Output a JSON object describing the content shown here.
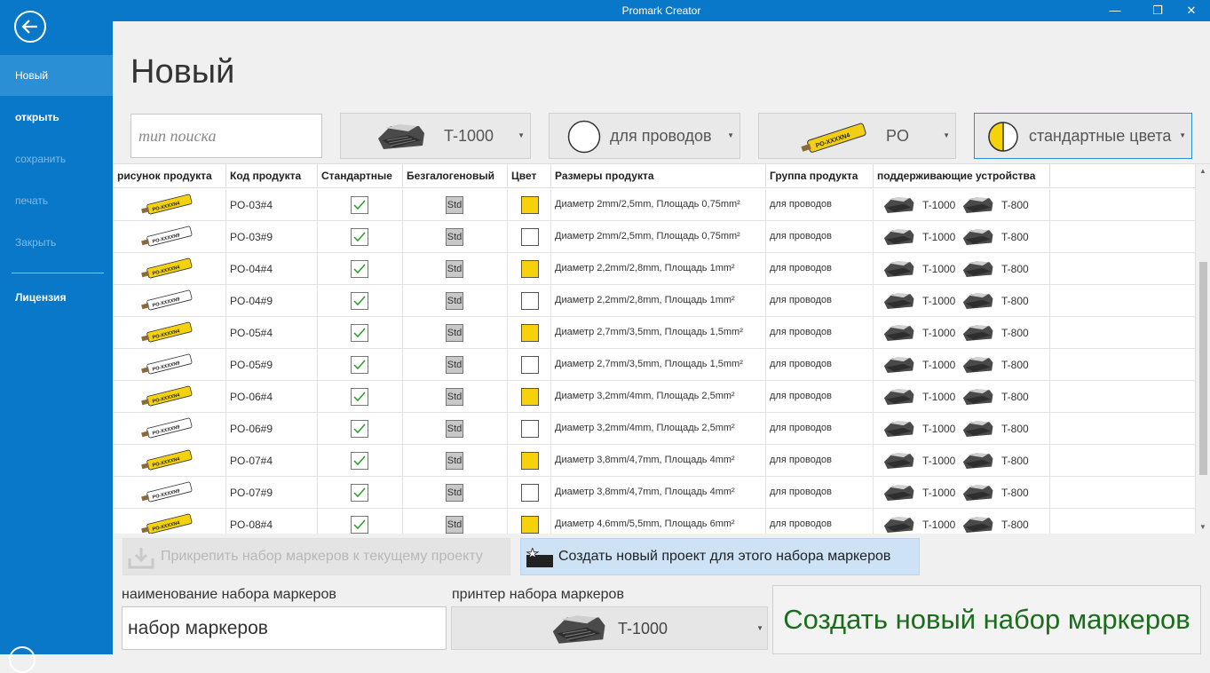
{
  "window": {
    "title": "Promark Creator"
  },
  "sidebar": {
    "items": [
      {
        "label": "Новый",
        "state": "active"
      },
      {
        "label": "открыть",
        "state": "bold"
      },
      {
        "label": "сохранить",
        "state": "disabled"
      },
      {
        "label": "печать",
        "state": "disabled"
      },
      {
        "label": "Закрыть",
        "state": "disabled"
      },
      {
        "label": "Лицензия",
        "state": "bold"
      }
    ]
  },
  "page": {
    "title": "Новый"
  },
  "search": {
    "placeholder": "тип поиска"
  },
  "filters": {
    "printer": "T-1000",
    "category": "для проводов",
    "series": "PO",
    "colors": "стандартные цвета"
  },
  "grid": {
    "headers": [
      "рисунок продукта",
      "Код продукта",
      "Стандартные",
      "Безгалогеновый",
      "Цвет",
      "Размеры продукта",
      "Группа продукта",
      "поддерживающие устройства"
    ],
    "rows": [
      {
        "code": "PO-03#4",
        "standard": true,
        "halogen_free": "Std",
        "color": "#f5d20a",
        "marker_text": "PO-XXXXN4",
        "size": "Диаметр 2mm/2,5mm, Площадь 0,75mm²",
        "group": "для проводов",
        "dev1": "T-1000",
        "dev2": "T-800"
      },
      {
        "code": "PO-03#9",
        "standard": true,
        "halogen_free": "Std",
        "color": "#ffffff",
        "marker_text": "PO-XXXXN9",
        "size": "Диаметр 2mm/2,5mm, Площадь 0,75mm²",
        "group": "для проводов",
        "dev1": "T-1000",
        "dev2": "T-800"
      },
      {
        "code": "PO-04#4",
        "standard": true,
        "halogen_free": "Std",
        "color": "#f5d20a",
        "marker_text": "PO-XXXXN4",
        "size": "Диаметр 2,2mm/2,8mm, Площадь 1mm²",
        "group": "для проводов",
        "dev1": "T-1000",
        "dev2": "T-800"
      },
      {
        "code": "PO-04#9",
        "standard": true,
        "halogen_free": "Std",
        "color": "#ffffff",
        "marker_text": "PO-XXXXN9",
        "size": "Диаметр 2,2mm/2,8mm, Площадь 1mm²",
        "group": "для проводов",
        "dev1": "T-1000",
        "dev2": "T-800"
      },
      {
        "code": "PO-05#4",
        "standard": true,
        "halogen_free": "Std",
        "color": "#f5d20a",
        "marker_text": "PO-XXXXN4",
        "size": "Диаметр 2,7mm/3,5mm, Площадь 1,5mm²",
        "group": "для проводов",
        "dev1": "T-1000",
        "dev2": "T-800"
      },
      {
        "code": "PO-05#9",
        "standard": true,
        "halogen_free": "Std",
        "color": "#ffffff",
        "marker_text": "PO-XXXXN9",
        "size": "Диаметр 2,7mm/3,5mm, Площадь 1,5mm²",
        "group": "для проводов",
        "dev1": "T-1000",
        "dev2": "T-800"
      },
      {
        "code": "PO-06#4",
        "standard": true,
        "halogen_free": "Std",
        "color": "#f5d20a",
        "marker_text": "PO-XXXXN4",
        "size": "Диаметр 3,2mm/4mm, Площадь 2,5mm²",
        "group": "для проводов",
        "dev1": "T-1000",
        "dev2": "T-800"
      },
      {
        "code": "PO-06#9",
        "standard": true,
        "halogen_free": "Std",
        "color": "#ffffff",
        "marker_text": "PO-XXXXN9",
        "size": "Диаметр 3,2mm/4mm, Площадь 2,5mm²",
        "group": "для проводов",
        "dev1": "T-1000",
        "dev2": "T-800"
      },
      {
        "code": "PO-07#4",
        "standard": true,
        "halogen_free": "Std",
        "color": "#f5d20a",
        "marker_text": "PO-XXXXN4",
        "size": "Диаметр 3,8mm/4,7mm, Площадь 4mm²",
        "group": "для проводов",
        "dev1": "T-1000",
        "dev2": "T-800"
      },
      {
        "code": "PO-07#9",
        "standard": true,
        "halogen_free": "Std",
        "color": "#ffffff",
        "marker_text": "PO-XXXXN9",
        "size": "Диаметр 3,8mm/4,7mm, Площадь 4mm²",
        "group": "для проводов",
        "dev1": "T-1000",
        "dev2": "T-800"
      },
      {
        "code": "PO-08#4",
        "standard": true,
        "halogen_free": "Std",
        "color": "#f5d20a",
        "marker_text": "PO-XXXXN4",
        "size": "Диаметр 4,6mm/5,5mm, Площадь 6mm²",
        "group": "для проводов",
        "dev1": "T-1000",
        "dev2": "T-800"
      }
    ]
  },
  "actions": {
    "attach": "Прикрепить набор маркеров к текущему проекту",
    "create_project": "Создать новый проект для этого набора маркеров"
  },
  "form": {
    "name_label": "наименование набора маркеров",
    "name_value": "набор маркеров",
    "printer_label": "принтер набора маркеров",
    "printer_value": "T-1000",
    "create_button": "Создать новый набор маркеров"
  }
}
